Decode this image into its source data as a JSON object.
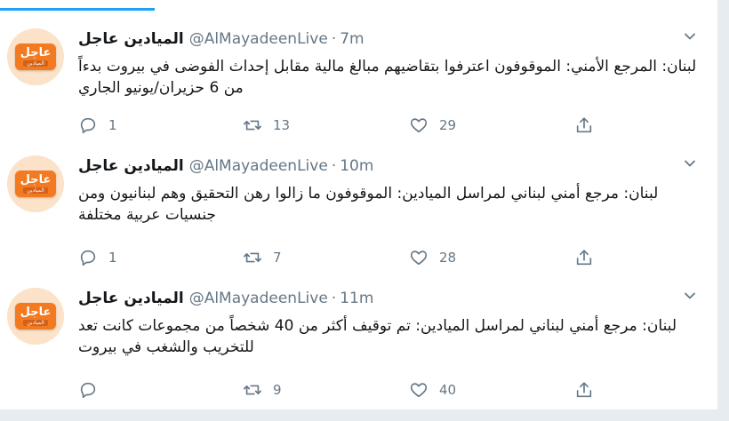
{
  "tweets": [
    {
      "name": "الميادين عاجل",
      "handle": "@AlMayadeenLive",
      "separator": "·",
      "time": "7m",
      "text": "لبنان: المرجع الأمني: الموقوفون اعترفوا بتقاضيهم مبالغ مالية مقابل إحداث الفوضى في بيروت بدءاً من 6 حزيران/يونيو الجاري",
      "replies": "1",
      "retweets": "13",
      "likes": "29"
    },
    {
      "name": "الميادين عاجل",
      "handle": "@AlMayadeenLive",
      "separator": "·",
      "time": "10m",
      "text": "لبنان: مرجع أمني لبناني لمراسل الميادين: الموقوفون ما زالوا رهن التحقيق وهم لبنانيون ومن جنسيات عربية مختلفة",
      "replies": "1",
      "retweets": "7",
      "likes": "28"
    },
    {
      "name": "الميادين عاجل",
      "handle": "@AlMayadeenLive",
      "separator": "·",
      "time": "11m",
      "text": "لبنان: مرجع أمني لبناني لمراسل الميادين: تم توقيف أكثر من 40 شخصاً من مجموعات كانت تعد للتخريب والشغب في بيروت",
      "replies": "",
      "retweets": "9",
      "likes": "40"
    }
  ],
  "avatar": {
    "brand_main": "عاجل",
    "brand_sub": "الميادين"
  },
  "colors": {
    "accent": "#1da1f2",
    "badge": "#f37a20",
    "muted": "#657786"
  },
  "icons": [
    "reply-icon",
    "retweet-icon",
    "like-icon",
    "share-icon",
    "chevron-down-icon"
  ]
}
